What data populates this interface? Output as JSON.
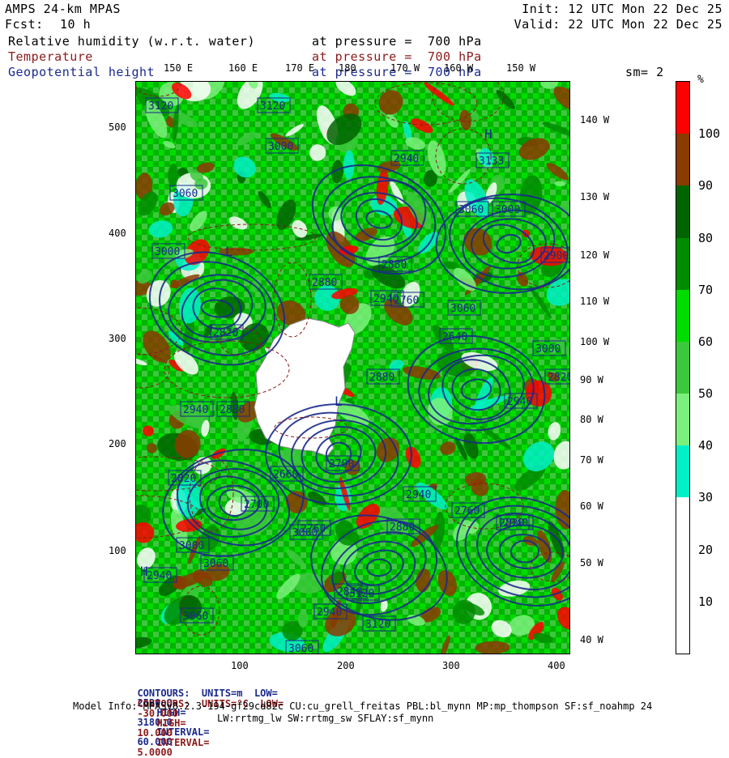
{
  "header": {
    "model": "AMPS 24-km MPAS",
    "init": "Init: 12 UTC Mon 22 Dec 25",
    "fcst_label": "Fcst:",
    "fcst_value": "10 h",
    "valid": "Valid: 22 UTC Mon 22 Dec 25",
    "fields": [
      {
        "name": "Relative humidity (w.r.t. water)",
        "level": "at pressure =  700 hPa",
        "color": "#000000"
      },
      {
        "name": "Temperature",
        "level": "at pressure =  700 hPa",
        "color": "#8b1a1a"
      },
      {
        "name": "Geopotential height",
        "level": "at pressure =  700 hPa",
        "color": "#1a2a8c"
      }
    ],
    "smoothing": "sm= 2"
  },
  "top_lon_labels": [
    "150 E",
    "160 E",
    "170 E",
    "180",
    "170 W",
    "160 W",
    "150 W"
  ],
  "right_lon_labels": [
    "140 W",
    "130 W",
    "120 W",
    "110 W",
    "100 W",
    "90 W",
    "80 W",
    "70 W",
    "60 W",
    "50 W",
    "40 W"
  ],
  "y_axis_labels": [
    "500",
    "400",
    "300",
    "200",
    "100"
  ],
  "x_axis_labels": [
    "100",
    "200",
    "300",
    "400"
  ],
  "height_labels": [
    "3120",
    "3120",
    "3000",
    "2940",
    "3133",
    "3060",
    "3000",
    "3060",
    "2900",
    "2880",
    "3000",
    "2940",
    "2880",
    "3060",
    "2820",
    "3000",
    "2760",
    "2940",
    "2640",
    "2880",
    "2820",
    "2880",
    "2940",
    "2700",
    "2790",
    "2820",
    "2660",
    "2760",
    "2940",
    "2760",
    "2820",
    "3000",
    "3060",
    "3060",
    "3120",
    "2940",
    "3060",
    "2940",
    "2840",
    "2940",
    "2880",
    "3120",
    "3060"
  ],
  "hl_markers": [
    "H",
    "L",
    "L",
    "H"
  ],
  "colorbar": {
    "unit": "%",
    "bins": [
      {
        "label": "100",
        "color": "#ff0000"
      },
      {
        "label": "90",
        "color": "#8b3a00"
      },
      {
        "label": "80",
        "color": "#006400"
      },
      {
        "label": "70",
        "color": "#008c00"
      },
      {
        "label": "60",
        "color": "#00dc00"
      },
      {
        "label": "50",
        "color": "#3cc83c"
      },
      {
        "label": "40",
        "color": "#7cf07c"
      },
      {
        "label": "30",
        "color": "#00f0c8"
      },
      {
        "label": "20",
        "color": "#ffffff"
      },
      {
        "label": "10",
        "color": "#ffffff"
      }
    ]
  },
  "footer": {
    "line1_prefix": "CONTOURS:  UNITS=m  LOW=",
    "line1_low": "2520.0",
    "line1_high_label": "HIGH=",
    "line1_high": "3180.0",
    "line1_int_label": "INTERVAL=",
    "line1_int": "60.000",
    "line2_prefix": "CONTOURS:  UNITS=°C  LOW=",
    "line2_low": "-30.000",
    "line2_high_label": "HIGH=",
    "line2_high": "10.000",
    "line2_int_label": "INTERVAL=",
    "line2_int": "5.0000",
    "model_info": "Model Info: MPASv8.2.3-194-gf29cd82c CU:cu_grell_freitas PBL:bl_mynn MP:mp_thompson SF:sf_noahmp 24",
    "model_info2": "LW:rrtmg_lw SW:rrtmg_sw SFLAY:sf_mynn"
  }
}
